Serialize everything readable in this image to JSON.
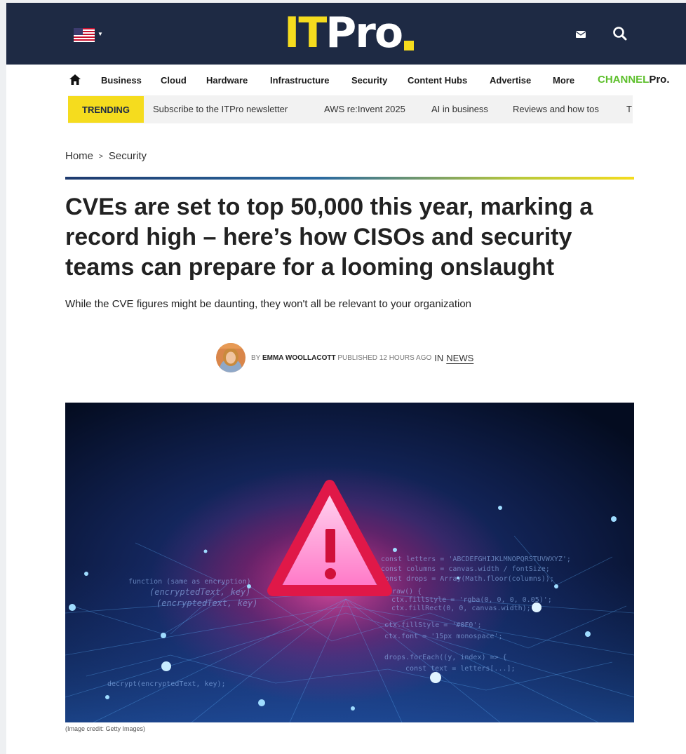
{
  "header": {
    "logo_it": "IT",
    "logo_pro": "Pro"
  },
  "nav": {
    "items": [
      "Business",
      "Cloud",
      "Hardware",
      "Infrastructure",
      "Security",
      "Content Hubs",
      "Advertise",
      "More"
    ],
    "channel_part1": "CHANNEL",
    "channel_part2": "Pro."
  },
  "trending": {
    "label": "TRENDING",
    "items": [
      "Subscribe to the ITPro newsletter",
      "AWS re:Invent 2025",
      "AI in business",
      "Reviews and how tos",
      "T"
    ]
  },
  "breadcrumb": {
    "home": "Home",
    "separator": ">",
    "current": "Security"
  },
  "article": {
    "headline": "CVEs are set to top 50,000 this year, marking a record high – here’s how CISOs and security teams can prepare for a looming onslaught",
    "standfirst": "While the CVE figures might be daunting, they won't all be relevant to your organization",
    "byline": {
      "by": "By",
      "author": "Emma Woollacott",
      "published": "Published 12 hours ago",
      "in": "IN",
      "category": "NEWS"
    },
    "image_credit": "(Image credit: Getty Images)"
  },
  "colors": {
    "header_bg": "#1e2a44",
    "accent_yellow": "#f5dc1e",
    "channel_green": "#5cbf2a"
  },
  "icons": [
    "us-flag-icon",
    "mail-icon",
    "search-icon",
    "home-icon"
  ]
}
